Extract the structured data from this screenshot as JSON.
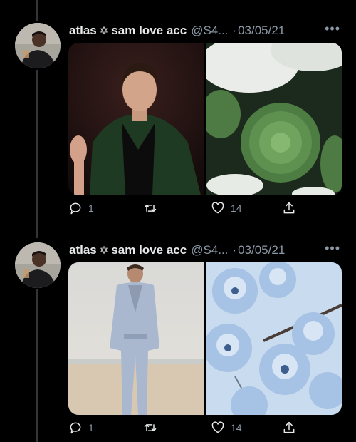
{
  "tweets": [
    {
      "display_name": "atlas",
      "star_glyph": "✡",
      "name_suffix": "sam love acc",
      "handle": "@S4...",
      "separator": "·",
      "date": "03/05/21",
      "more_glyph": "•••",
      "replies": "1",
      "retweets": "",
      "likes": "14",
      "media": [
        "man-in-green-leather-jacket-photo",
        "green-chrysanthemum-photo"
      ]
    },
    {
      "display_name": "atlas",
      "star_glyph": "✡",
      "name_suffix": "sam love acc",
      "handle": "@S4...",
      "separator": "·",
      "date": "03/05/21",
      "more_glyph": "•••",
      "replies": "1",
      "retweets": "",
      "likes": "14",
      "media": [
        "man-in-light-blue-suit-beach-photo",
        "blue-blossoms-photo"
      ]
    }
  ],
  "icons": {
    "reply": "reply-icon",
    "retweet": "retweet-icon",
    "like": "heart-icon",
    "share": "share-icon",
    "more": "more-options-icon"
  },
  "colors": {
    "background": "#000000",
    "primary_text": "#e7e9ea",
    "secondary_text": "#8b98a5",
    "thread_line": "#333639"
  }
}
